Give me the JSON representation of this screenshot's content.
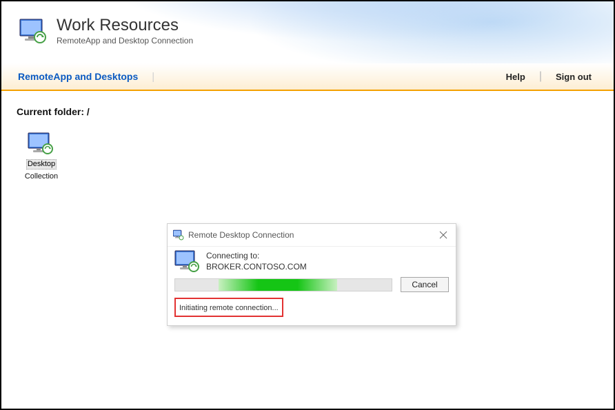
{
  "header": {
    "title": "Work Resources",
    "subtitle": "RemoteApp and Desktop Connection"
  },
  "nav": {
    "tab1": "RemoteApp and Desktops",
    "help": "Help",
    "signout": "Sign out"
  },
  "main": {
    "folder_label": "Current folder: /",
    "items": [
      {
        "line1": "Desktop",
        "line2": "Collection"
      }
    ]
  },
  "dialog": {
    "title": "Remote Desktop Connection",
    "connecting_label": "Connecting to:",
    "target": "BROKER.CONTOSO.COM",
    "cancel": "Cancel",
    "status": "Initiating remote connection..."
  }
}
